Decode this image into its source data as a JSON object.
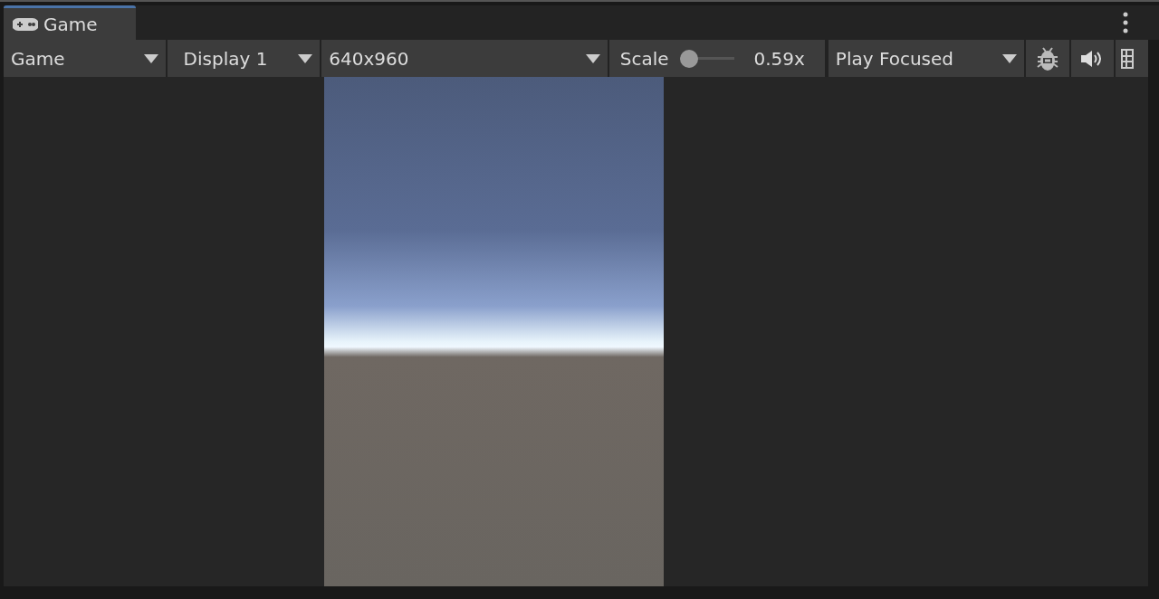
{
  "tabs": [
    {
      "label": "Game",
      "selected": true
    }
  ],
  "toolbar": {
    "view_dropdown": "Game",
    "display_dropdown": "Display 1",
    "resolution_dropdown": "640x960",
    "scale": {
      "label": "Scale",
      "level": 0,
      "reading": "0.59x"
    },
    "play_mode_dropdown": "Play Focused",
    "stats_toggle": {
      "on": false
    },
    "mute_toggle": {
      "on": false
    }
  }
}
